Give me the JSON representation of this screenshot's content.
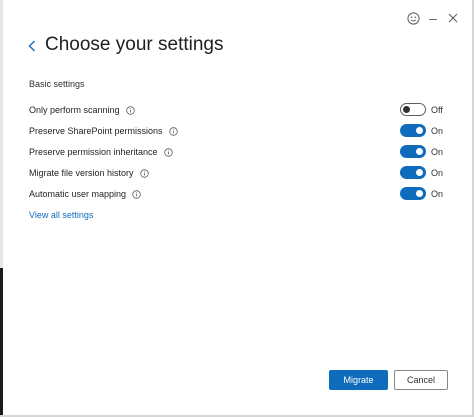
{
  "window": {
    "feedback_icon": "smiley-icon",
    "minimize_glyph": "–",
    "close_icon": "close-icon"
  },
  "header": {
    "back_icon": "chevron-left-icon",
    "title": "Choose your settings"
  },
  "section": {
    "label": "Basic settings"
  },
  "settings": [
    {
      "label": "Only perform scanning",
      "state": "Off",
      "enabled": false
    },
    {
      "label": "Preserve SharePoint permissions",
      "state": "On",
      "enabled": true
    },
    {
      "label": "Preserve permission inheritance",
      "state": "On",
      "enabled": true
    },
    {
      "label": "Migrate file version history",
      "state": "On",
      "enabled": true
    },
    {
      "label": "Automatic user mapping",
      "state": "On",
      "enabled": true
    }
  ],
  "view_all_link": "View all settings",
  "footer": {
    "primary_label": "Migrate",
    "secondary_label": "Cancel"
  },
  "colors": {
    "accent": "#0f6cbd",
    "text": "#201f1e",
    "toggle_off_border": "#605e5c"
  }
}
